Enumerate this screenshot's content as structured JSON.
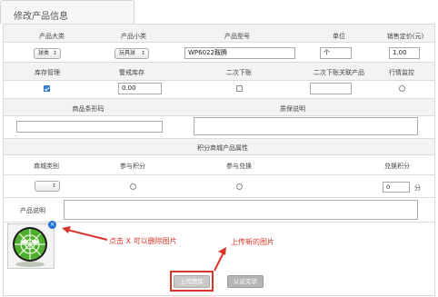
{
  "tab": {
    "title": "修改产品信息"
  },
  "row1": {
    "headers": [
      "产品大类",
      "产品小类",
      "产品型号",
      "单位",
      "销售定价(元)"
    ],
    "category_value": "球类",
    "subcategory_value": "玩具球",
    "model_value": "WP6022鞍腾",
    "unit_value": "个",
    "price_value": "1.00"
  },
  "row2": {
    "headers": [
      "库存管理",
      "警戒库存",
      "二次下账",
      "二次下账关联产品",
      "行情监控"
    ],
    "inventory_checked": true,
    "alert_value": "0.00",
    "secondary_checked": false,
    "monitor_checked": false
  },
  "row3": {
    "headers": [
      "商品条形码",
      "质保说明"
    ]
  },
  "points": {
    "section_title": "积分商城产品属性",
    "headers": [
      "商城类别",
      "参与积分",
      "参与兑换",
      "兑换积分"
    ],
    "exchange_value": "0",
    "unit_label": "分"
  },
  "description": {
    "label": "产品说明"
  },
  "annotations": {
    "delete_hint": "点击 X 可以删除图片",
    "upload_hint": "上传新的图片"
  },
  "buttons": {
    "upload": "上传图库",
    "confirm": "认证完毕"
  },
  "colors": {
    "annotation": "#d9362b",
    "upload_button": "#c9c9c9",
    "confirm_button": "#b5b5b5",
    "checkbox_checked": "#3b86d8"
  }
}
